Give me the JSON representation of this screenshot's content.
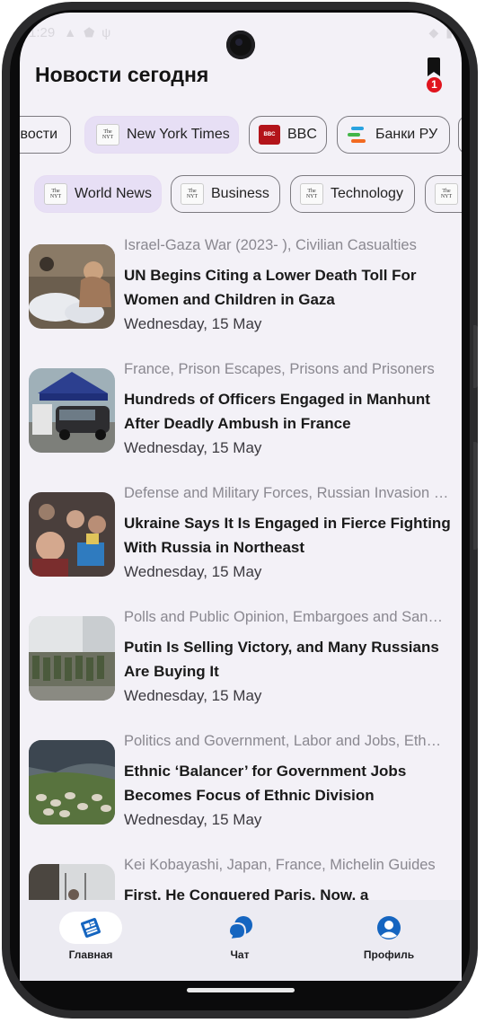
{
  "status": {
    "time": "1:29"
  },
  "header": {
    "title": "Новости сегодня",
    "bookmark_count": "1"
  },
  "sources": [
    {
      "label": "Новости",
      "logo": "generic"
    },
    {
      "label": "New York Times",
      "logo": "nyt",
      "selected": true
    },
    {
      "label": "BBC",
      "logo": "bbc"
    },
    {
      "label": "Банки РУ",
      "logo": "bank"
    }
  ],
  "categories": [
    {
      "label": "World News",
      "selected": true
    },
    {
      "label": "Business"
    },
    {
      "label": "Technology"
    },
    {
      "label": ""
    }
  ],
  "news": [
    {
      "tags": "Israel-Gaza War (2023- ), Civilian Casualties",
      "title": "UN Begins Citing a Lower Death Toll For Women and Children in Gaza",
      "date": "Wednesday, 15 May"
    },
    {
      "tags": "France, Prison Escapes, Prisons and Prisoners",
      "title": "Hundreds of Officers Engaged in Manhunt After Deadly Ambush in France",
      "date": "Wednesday, 15 May"
    },
    {
      "tags": "Defense and Military Forces, Russian Invasion of Ukraine",
      "title": "Ukraine Says It Is Engaged in Fierce Fighting With Russia in Northeast",
      "date": "Wednesday, 15 May"
    },
    {
      "tags": "Polls and Public Opinion, Embargoes and Sanctions",
      "title": "Putin Is Selling Victory, and Many Russians Are Buying It",
      "date": "Wednesday, 15 May"
    },
    {
      "tags": "Politics and Government, Labor and Jobs, Ethnicity",
      "title": "Ethnic ‘Balancer’ for Government Jobs Becomes Focus of Ethnic Division",
      "date": "Wednesday, 15 May"
    },
    {
      "tags": "Kei Kobayashi, Japan, France, Michelin Guides",
      "title": "First, He Conquered Paris. Now, a",
      "date": ""
    }
  ],
  "nav": {
    "home": "Главная",
    "chat": "Чат",
    "profile": "Профиль"
  },
  "colors": {
    "accent": "#1565c0",
    "selected_chip": "#e7dff5",
    "badge": "#e0141e"
  }
}
